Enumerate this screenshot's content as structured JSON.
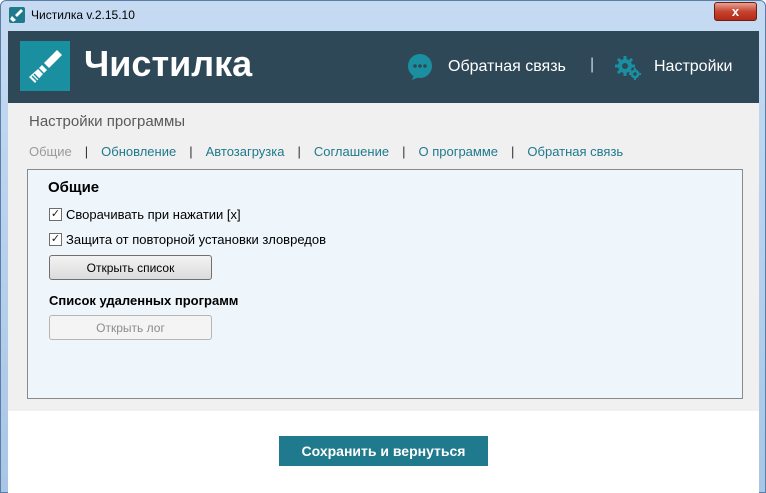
{
  "window": {
    "title": "Чистилка v.2.15.10",
    "close_label": "x"
  },
  "header": {
    "logo_text": "Чистилка",
    "feedback_label": "Обратная связь",
    "separator": "|",
    "settings_label": "Настройки"
  },
  "settings": {
    "section_title": "Настройки программы",
    "tabs": [
      {
        "label": "Общие",
        "active": true
      },
      {
        "label": "Обновление",
        "active": false
      },
      {
        "label": "Автозагрузка",
        "active": false
      },
      {
        "label": "Соглашение",
        "active": false
      },
      {
        "label": "О программе",
        "active": false
      },
      {
        "label": "Обратная связь",
        "active": false
      }
    ],
    "tab_separator": "|"
  },
  "panel": {
    "heading": "Общие",
    "checkboxes": [
      {
        "label": "Сворачивать при нажатии [x]",
        "checked": true
      },
      {
        "label": "Защита от повторной установки зловредов",
        "checked": true
      }
    ],
    "open_list_button": "Открыть список",
    "removed_programs_heading": "Список удаленных программ",
    "open_log_button": "Открыть лог",
    "open_log_enabled": false
  },
  "footer": {
    "save_button": "Сохранить и вернуться"
  },
  "colors": {
    "header_bg": "#2f4858",
    "accent": "#1e7a8c",
    "logo_bg": "#1a8fa0",
    "panel_bg": "#eef5fb"
  },
  "icons": {
    "app": "broom-icon",
    "feedback": "chat-bubble-icon",
    "settings": "gear-icon"
  }
}
